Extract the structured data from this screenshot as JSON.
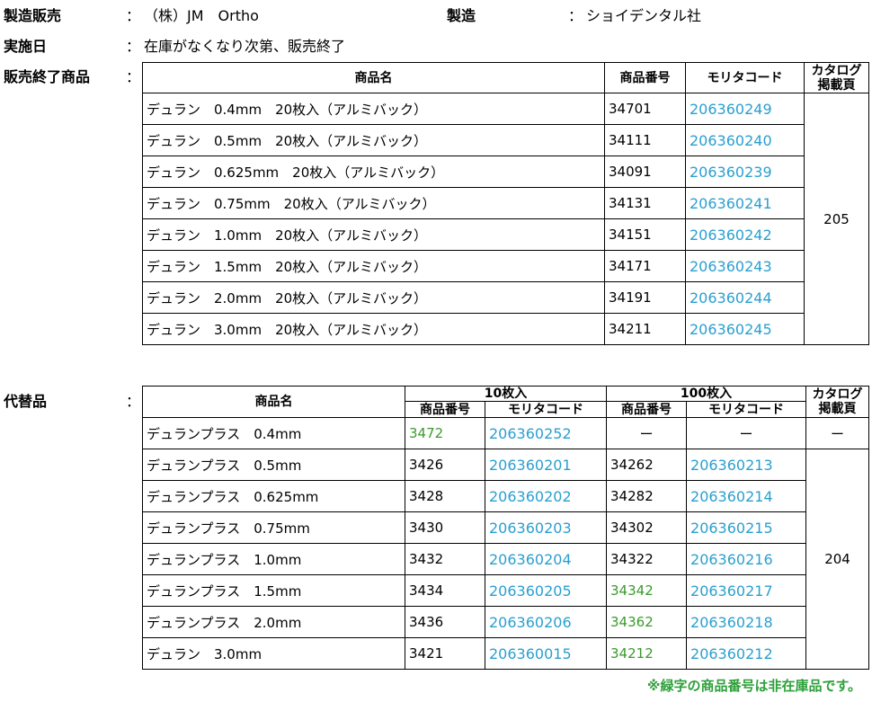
{
  "header": {
    "maker_seller_label": "製造販売",
    "maker_seller_colon": "：",
    "maker_seller_value": "（株）JM　Ortho",
    "manufacturer_label": "製造",
    "manufacturer_colon": "：",
    "manufacturer_value": "ショイデンタル社",
    "date_label": "実施日",
    "date_colon": "：",
    "date_value": "在庫がなくなり次第、販売終了",
    "discontinued_label": "販売終了商品",
    "discontinued_colon": "：",
    "substitute_label": "代替品",
    "substitute_colon": "："
  },
  "discontinued": {
    "col_name": "商品名",
    "col_code": "商品番号",
    "col_morita": "モリタコード",
    "col_catalog": "カタログ\n掲載頁",
    "catalog_page": "205",
    "rows": [
      {
        "name": "デュラン　0.4mm　20枚入（アルミバック）",
        "code": "34701",
        "morita": "206360249"
      },
      {
        "name": "デュラン　0.5mm　20枚入（アルミバック）",
        "code": "34111",
        "morita": "206360240"
      },
      {
        "name": "デュラン　0.625mm　20枚入（アルミバック）",
        "code": "34091",
        "morita": "206360239"
      },
      {
        "name": "デュラン　0.75mm　20枚入（アルミバック）",
        "code": "34131",
        "morita": "206360241"
      },
      {
        "name": "デュラン　1.0mm　20枚入（アルミバック）",
        "code": "34151",
        "morita": "206360242"
      },
      {
        "name": "デュラン　1.5mm　20枚入（アルミバック）",
        "code": "34171",
        "morita": "206360243"
      },
      {
        "name": "デュラン　2.0mm　20枚入（アルミバック）",
        "code": "34191",
        "morita": "206360244"
      },
      {
        "name": "デュラン　3.0mm　20枚入（アルミバック）",
        "code": "34211",
        "morita": "206360245"
      }
    ]
  },
  "substitute": {
    "col_name": "商品名",
    "group_10": "10枚入",
    "group_100": "100枚入",
    "col_code": "商品番号",
    "col_morita": "モリタコード",
    "col_catalog": "カタログ\n掲載頁",
    "first_row_catalog": "ー",
    "catalog_page": "204",
    "rows": [
      {
        "name": "デュランプラス　0.4mm",
        "code10": "3472",
        "code10_color": "green",
        "morita10": "206360252",
        "code100": "ー",
        "code100_color": "black",
        "morita100": "ー",
        "morita100_color": "black"
      },
      {
        "name": "デュランプラス　0.5mm",
        "code10": "3426",
        "code10_color": "black",
        "morita10": "206360201",
        "code100": "34262",
        "code100_color": "black",
        "morita100": "206360213",
        "morita100_color": "blue"
      },
      {
        "name": "デュランプラス　0.625mm",
        "code10": "3428",
        "code10_color": "black",
        "morita10": "206360202",
        "code100": "34282",
        "code100_color": "black",
        "morita100": "206360214",
        "morita100_color": "blue"
      },
      {
        "name": "デュランプラス　0.75mm",
        "code10": "3430",
        "code10_color": "black",
        "morita10": "206360203",
        "code100": "34302",
        "code100_color": "black",
        "morita100": "206360215",
        "morita100_color": "blue"
      },
      {
        "name": "デュランプラス　1.0mm",
        "code10": "3432",
        "code10_color": "black",
        "morita10": "206360204",
        "code100": "34322",
        "code100_color": "black",
        "morita100": "206360216",
        "morita100_color": "blue"
      },
      {
        "name": "デュランプラス　1.5mm",
        "code10": "3434",
        "code10_color": "black",
        "morita10": "206360205",
        "code100": "34342",
        "code100_color": "green",
        "morita100": "206360217",
        "morita100_color": "blue"
      },
      {
        "name": "デュランプラス　2.0mm",
        "code10": "3436",
        "code10_color": "black",
        "morita10": "206360206",
        "code100": "34362",
        "code100_color": "green",
        "morita100": "206360218",
        "morita100_color": "blue"
      },
      {
        "name": "デュラン　3.0mm",
        "code10": "3421",
        "code10_color": "black",
        "morita10": "206360015",
        "code100": "34212",
        "code100_color": "green",
        "morita100": "206360212",
        "morita100_color": "blue"
      }
    ]
  },
  "footnote": "※緑字の商品番号は非在庫品です。",
  "colors": {
    "morita_blue": "#2a9fd0",
    "nonstock_green": "#3a9a2c"
  }
}
